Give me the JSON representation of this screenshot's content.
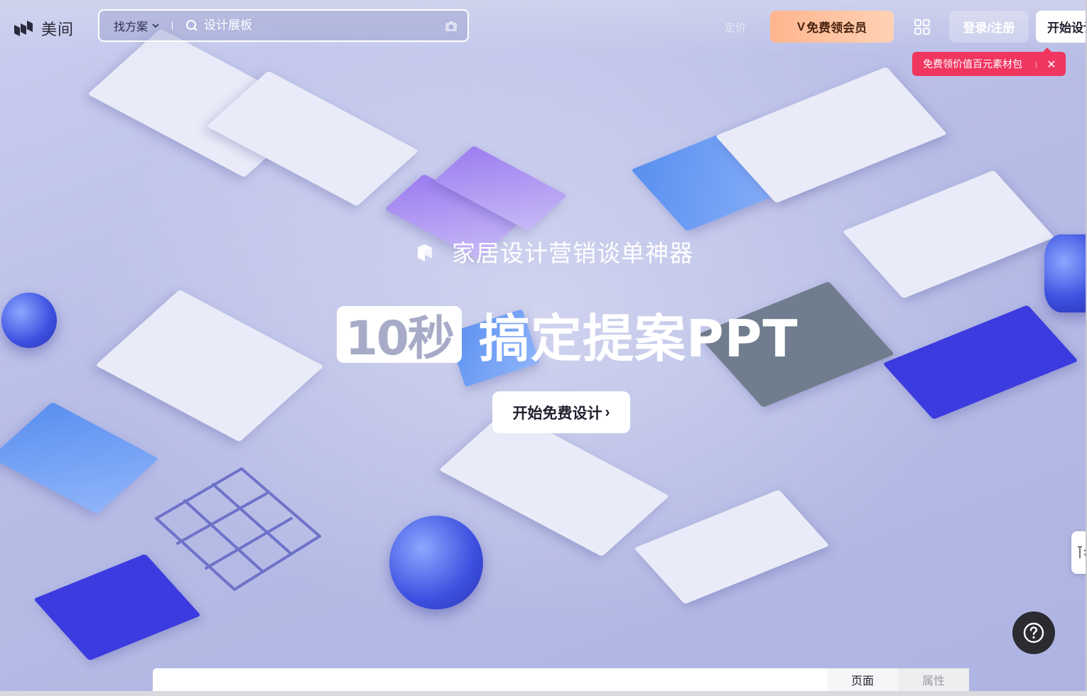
{
  "header": {
    "logo_text": "美间",
    "search_scope": "找方案",
    "search_placeholder": "设计展板",
    "faded_nav": "定价",
    "vip_label": "免费领会员",
    "vip_prefix": "V",
    "login_label": "登录/注册",
    "start_label": "开始设计"
  },
  "promo": {
    "text": "免费领价值百元素材包",
    "close": "✕"
  },
  "hero": {
    "subtitle": "家居设计营销谈单神器",
    "badge": "10秒",
    "headline": "搞定提案PPT",
    "cta_label": "开始免费设计",
    "cta_arrow": "›"
  },
  "help": {
    "icon": "question-icon"
  },
  "bottom_panel": {
    "tab_page": "页面",
    "tab_props": "属性"
  },
  "colors": {
    "vip_gradient_start": "#ffb58e",
    "vip_gradient_end": "#ffd2b5",
    "promo_bg": "#f0365f",
    "help_bg": "#2b2b30"
  }
}
